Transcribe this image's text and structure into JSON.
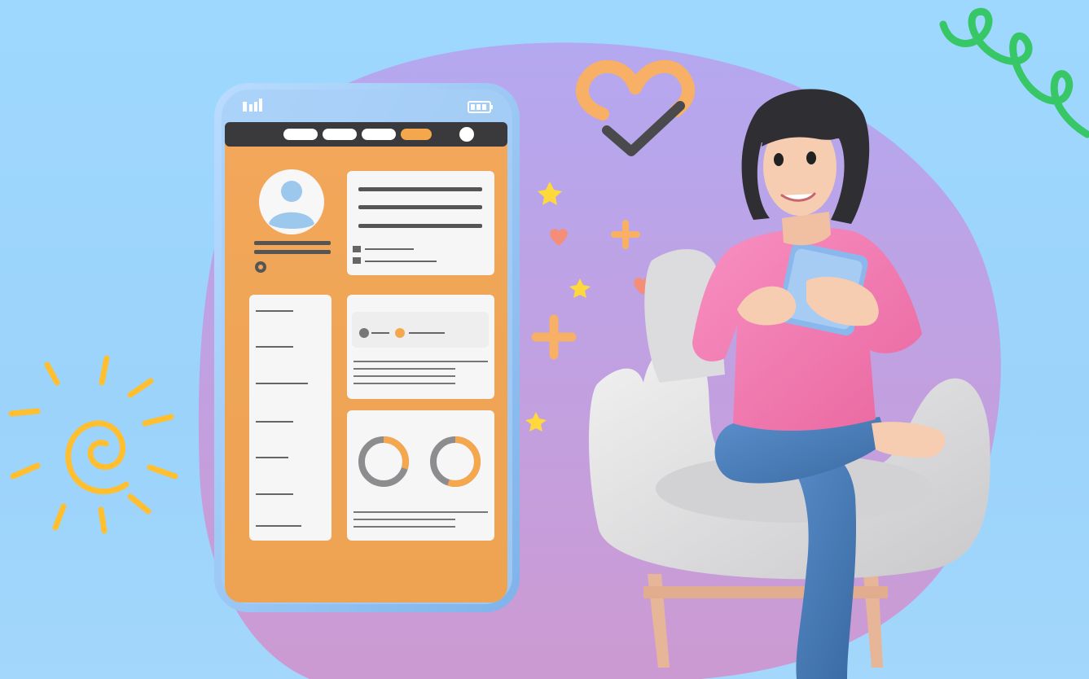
{
  "scene": {
    "palette": {
      "sky": "#9dd6fe",
      "blob_top": "#b9a6ec",
      "blob_bottom": "#c99ad8",
      "phone_frame": "#8ec0ef",
      "screen_orange": "#f1a656",
      "card_white": "#f6f6f6",
      "accent_orange": "#f5a74e",
      "sun_yellow": "#ffbf2e",
      "squiggle_green": "#38c766",
      "sweater_pink": "#f57fb6",
      "jeans_blue": "#4c7fb8",
      "chair_gray": "#e3e3e3",
      "heart_coral": "#f48e79",
      "star_yellow": "#ffd93b"
    },
    "icons": [
      "signal-icon",
      "battery-icon",
      "avatar-icon",
      "gear-icon",
      "heart-icon",
      "checkmark-icon",
      "sun-icon",
      "squiggle-icon",
      "star-icon",
      "plus-icon"
    ],
    "phone_mockup": {
      "active_tab_index": 3,
      "tab_count": 4,
      "donut_progress": [
        0.3,
        0.55
      ]
    }
  }
}
